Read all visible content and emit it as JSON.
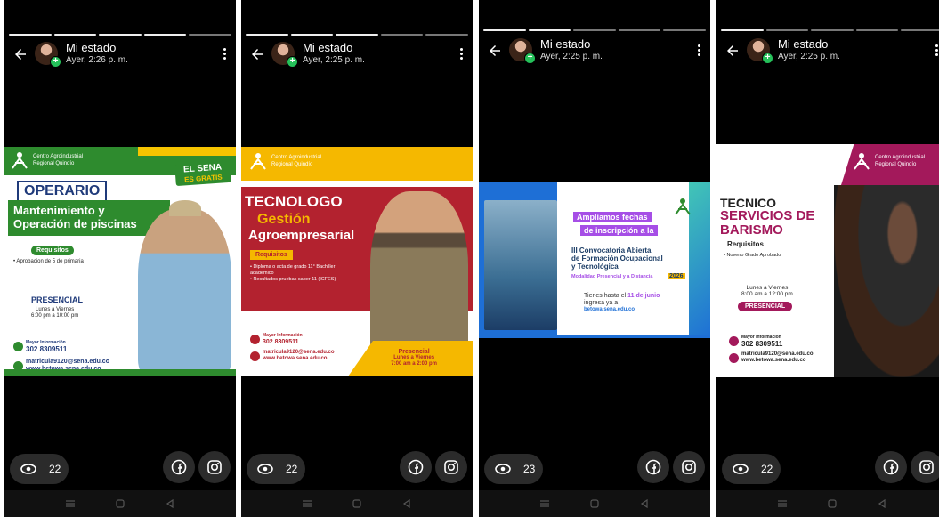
{
  "statuses": [
    {
      "header": {
        "name": "Mi estado",
        "time": "Ayer, 2:26 p. m."
      },
      "views": "22",
      "post": {
        "org": "SENA",
        "center": "Centro Agroindustrial",
        "region": "Regional Quindío",
        "badge_top": "EL SENA",
        "badge_bottom": "ES GRATIS",
        "title": "OPERARIO",
        "subtitle": "Mantenimiento y Operación de piscinas",
        "req_label": "Requisitos",
        "req_item": "• Aprobacion de 5 de primaria",
        "mode": "PRESENCIAL",
        "days": "Lunes a Viernes",
        "hours": "6:00 pm a 10:00 pm",
        "info_label": "Mayor Información",
        "phone": "302 8309511",
        "email": "matricula9120@sena.edu.co",
        "web": "www.betowa.sena.edu.co"
      }
    },
    {
      "header": {
        "name": "Mi estado",
        "time": "Ayer, 2:25 p. m."
      },
      "views": "22",
      "post": {
        "org": "SENA",
        "center": "Centro Agroindustrial",
        "region": "Regional Quindío",
        "title": "TECNOLOGO",
        "subtitle1": "Gestión",
        "subtitle2": "Agroempresarial",
        "req_label": "Requisitos",
        "req_item1": "• Diploma o acta de grado 11° Bachiller académico",
        "req_item2": "• Resultados pruebas saber 11 (ICFES)",
        "info_label": "Mayor Información",
        "phone": "302 8309511",
        "email": "matricula9120@sena.edu.co",
        "web": "www.betowa.sena.edu.co",
        "mode": "Presencial",
        "days": "Lunes a Viernes",
        "hours": "7:00 am a 2:00 pm"
      }
    },
    {
      "header": {
        "name": "Mi estado",
        "time": "Ayer, 2:25 p. m."
      },
      "views": "23",
      "post": {
        "line1": "Ampliamos fechas",
        "line2": "de inscripción a la",
        "conv1": "III Convocatoria Abierta",
        "conv2": "de Formación Ocupacional",
        "conv3": "y Tecnológica",
        "modality": "Modalidad Presencial y a Distancia",
        "year": "2026",
        "until_prefix": "Tienes hasta el",
        "until_date": "11 de junio",
        "until_suffix": "ingresa ya a",
        "url": "betowa.sena.edu.co"
      }
    },
    {
      "header": {
        "name": "Mi estado",
        "time": "Ayer, 2:25 p. m."
      },
      "views": "22",
      "post": {
        "org": "SENA",
        "center": "Centro Agroindustrial",
        "region": "Regional Quindío",
        "title": "TECNICO",
        "subtitle1": "SERVICIOS DE",
        "subtitle2": "BARISMO",
        "req_label": "Requisitos",
        "req_item": "• Noveno Grado Aprobado",
        "days": "Lunes a Viernes",
        "hours": "8:00 am a 12:00 pm",
        "mode": "PRESENCIAL",
        "info_label": "Mayor Información",
        "phone": "302 8309511",
        "email": "matricula9120@sena.edu.co",
        "web": "www.betowa.sena.edu.co"
      }
    }
  ],
  "colors": {
    "sena_green": "#2e8b2e",
    "sena_yellow": "#f6c400",
    "red": "#b3222f",
    "purple": "#a64ee6",
    "magenta": "#a3195b",
    "blue": "#1e6fd6"
  },
  "icons": [
    "back-arrow-icon",
    "more-vert-icon",
    "eye-icon",
    "facebook-icon",
    "instagram-icon",
    "nav-recents-icon",
    "nav-home-icon",
    "nav-back-icon"
  ]
}
